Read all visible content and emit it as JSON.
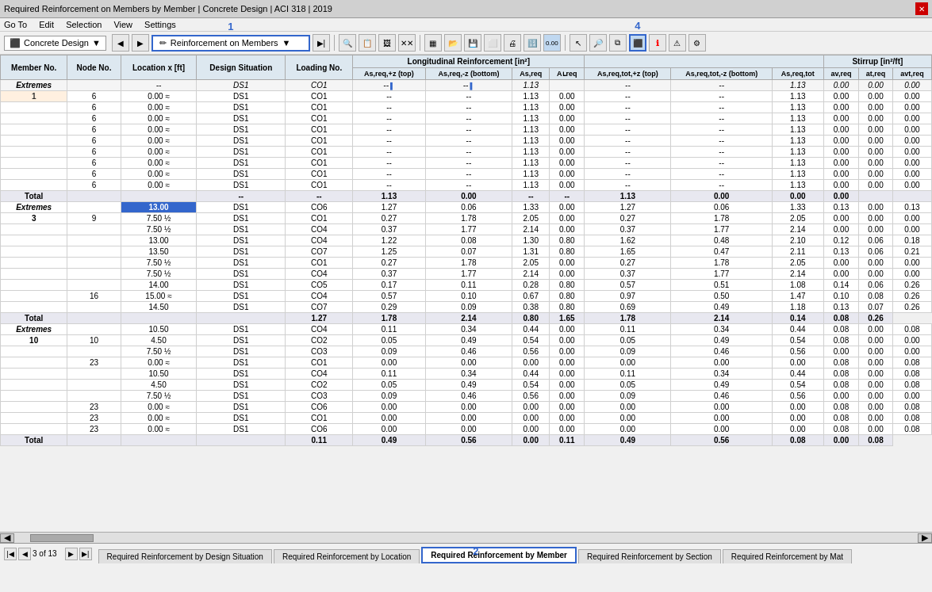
{
  "titleBar": {
    "text": "Required Reinforcement on Members by Member | Concrete Design | ACI 318 | 2019",
    "closeLabel": "✕"
  },
  "menuBar": {
    "items": [
      "Go To",
      "Edit",
      "Selection",
      "View",
      "Settings"
    ]
  },
  "toolbar": {
    "concreteDesignLabel": "Concrete Design",
    "selectedView": "Reinforcement on Members",
    "label1": "1",
    "label4": "4"
  },
  "tableHeaders": {
    "memberNo": "Member No.",
    "nodeNo": "Node No.",
    "locationX": "Location x [ft]",
    "designSituation": "Design Situation",
    "loadingNo": "Loading No.",
    "longitudinalGroup": "Longitudinal Reinforcement [in²]",
    "stirrupGroup": "Stirrup [in²/ft]",
    "asReqTopPlus": "As,req,+z (top)",
    "asReqBottomMinus": "As,req,-z (bottom)",
    "asReq": "As,req",
    "aAreq": "Aʟreq",
    "asReqTotTopPlus": "As,req,tot,+z (top)",
    "asReqTotBottomMinus": "As,req,tot,-z (bottom)",
    "asReqTot": "As,req,tot",
    "avReq": "av,req",
    "atReq": "at,req",
    "avtReq": "avt,req"
  },
  "sections": [
    {
      "type": "extremes",
      "memberNo": "Extremes",
      "rows": [
        {
          "nodeNo": "",
          "location": "--",
          "design": "DS1",
          "loading": "CO1",
          "top": "--",
          "bottom": "--",
          "asreq": "1.13",
          "aareq": "",
          "totTop": "--",
          "totBottom": "--",
          "totAs": "1.13",
          "av": "0.00",
          "at": "0.00",
          "avt": "0.00",
          "hasIndicatorTop": false,
          "hasIndicatorBottom": false
        }
      ],
      "memberLabel": "1",
      "dataRows": [
        {
          "nodeNo": "6",
          "location": "0.00 ≈",
          "design": "DS1",
          "loading": "CO1",
          "top": "--",
          "bottom": "--",
          "asreq": "1.13",
          "aareq": "0.00",
          "totTop": "--",
          "totBottom": "--",
          "totAs": "1.13",
          "av": "0.00",
          "at": "0.00",
          "avt": "0.00"
        },
        {
          "nodeNo": "6",
          "location": "0.00 ≈",
          "design": "DS1",
          "loading": "CO1",
          "top": "--",
          "bottom": "--",
          "asreq": "1.13",
          "aareq": "0.00",
          "totTop": "--",
          "totBottom": "--",
          "totAs": "1.13",
          "av": "0.00",
          "at": "0.00",
          "avt": "0.00",
          "indB": true
        },
        {
          "nodeNo": "6",
          "location": "0.00 ≈",
          "design": "DS1",
          "loading": "CO1",
          "top": "--",
          "bottom": "--",
          "asreq": "1.13",
          "aareq": "0.00",
          "totTop": "--",
          "totBottom": "--",
          "totAs": "1.13",
          "av": "0.00",
          "at": "0.00",
          "avt": "0.00",
          "indB2": true
        },
        {
          "nodeNo": "6",
          "location": "0.00 ≈",
          "design": "DS1",
          "loading": "CO1",
          "top": "--",
          "bottom": "--",
          "asreq": "1.13",
          "aareq": "0.00",
          "totTop": "--",
          "totBottom": "--",
          "totAs": "1.13",
          "av": "0.00",
          "at": "0.00",
          "avt": "0.00"
        },
        {
          "nodeNo": "6",
          "location": "0.00 ≈",
          "design": "DS1",
          "loading": "CO1",
          "top": "--",
          "bottom": "--",
          "asreq": "1.13",
          "aareq": "0.00",
          "totTop": "--",
          "totBottom": "--",
          "totAs": "1.13",
          "av": "0.00",
          "at": "0.00",
          "avt": "0.00"
        },
        {
          "nodeNo": "6",
          "location": "0.00 ≈",
          "design": "DS1",
          "loading": "CO1",
          "top": "--",
          "bottom": "--",
          "asreq": "1.13",
          "aareq": "0.00",
          "totTop": "--",
          "totBottom": "--",
          "totAs": "1.13",
          "av": "0.00",
          "at": "0.00",
          "avt": "0.00",
          "indT": true
        },
        {
          "nodeNo": "6",
          "location": "0.00 ≈",
          "design": "DS1",
          "loading": "CO1",
          "top": "--",
          "bottom": "--",
          "asreq": "1.13",
          "aareq": "0.00",
          "totTop": "--",
          "totBottom": "--",
          "totAs": "1.13",
          "av": "0.00",
          "at": "0.00",
          "avt": "0.00",
          "indTot": true
        },
        {
          "nodeNo": "6",
          "location": "0.00 ≈",
          "design": "DS1",
          "loading": "CO1",
          "top": "--",
          "bottom": "--",
          "asreq": "1.13",
          "aareq": "0.00",
          "totTop": "--",
          "totBottom": "--",
          "totAs": "1.13",
          "av": "0.00",
          "at": "0.00",
          "avt": "0.00",
          "indAt": true
        },
        {
          "nodeNo": "6",
          "location": "0.00 ≈",
          "design": "DS1",
          "loading": "CO1",
          "top": "--",
          "bottom": "--",
          "asreq": "1.13",
          "aareq": "0.00",
          "totTop": "--",
          "totBottom": "--",
          "totAs": "1.13",
          "av": "0.00",
          "at": "0.00",
          "avt": "0.00",
          "indAvt": true
        }
      ],
      "total": {
        "top": "--",
        "bottom": "--",
        "asreq": "1.13",
        "aareq": "0.00",
        "totTop": "--",
        "totBottom": "--",
        "totAs": "1.13",
        "av": "0.00",
        "at": "0.00",
        "avt": "0.00"
      }
    }
  ],
  "section3": {
    "memberNo": "3",
    "extremes": {
      "nodeNo": "",
      "location": "13.00",
      "design": "DS1",
      "loading": "CO6",
      "top": "1.27",
      "bottom": "0.06",
      "asreq": "1.33",
      "aareq": "0.00",
      "totTop": "1.27",
      "totBottom": "0.06",
      "totAs": "1.33",
      "av": "0.13",
      "at": "0.00",
      "avt": "0.13",
      "highlighted": true
    },
    "rows": [
      {
        "nodeNo": "9",
        "location": "7.50 ½",
        "design": "DS1",
        "loading": "CO1",
        "top": "0.27",
        "bottom": "1.78",
        "asreq": "2.05",
        "aareq": "0.00",
        "totTop": "0.27",
        "totBottom": "1.78",
        "totAs": "2.05",
        "av": "0.00",
        "at": "0.00",
        "avt": "0.00",
        "indB": true
      },
      {
        "nodeNo": "",
        "location": "7.50 ½",
        "design": "DS1",
        "loading": "CO4",
        "top": "0.37",
        "bottom": "1.77",
        "asreq": "2.14",
        "aareq": "0.00",
        "totTop": "0.37",
        "totBottom": "1.77",
        "totAs": "2.14",
        "av": "0.00",
        "at": "0.00",
        "avt": "0.00",
        "indT": true
      },
      {
        "nodeNo": "",
        "location": "13.00",
        "design": "DS1",
        "loading": "CO4",
        "top": "1.22",
        "bottom": "0.08",
        "asreq": "1.30",
        "aareq": "0.80",
        "totTop": "1.62",
        "totBottom": "0.48",
        "totAs": "2.10",
        "av": "0.12",
        "at": "0.06",
        "avt": "0.18"
      },
      {
        "nodeNo": "",
        "location": "13.50",
        "design": "DS1",
        "loading": "CO7",
        "top": "1.25",
        "bottom": "0.07",
        "asreq": "1.31",
        "aareq": "0.80",
        "totTop": "1.65",
        "totBottom": "0.47",
        "totAs": "2.11",
        "av": "0.13",
        "at": "0.06",
        "avt": "0.21",
        "indTot2": true
      },
      {
        "nodeNo": "",
        "location": "7.50 ½",
        "design": "DS1",
        "loading": "CO1",
        "top": "0.27",
        "bottom": "1.78",
        "asreq": "2.05",
        "aareq": "0.00",
        "totTop": "0.27",
        "totBottom": "1.78",
        "totAs": "2.05",
        "av": "0.00",
        "at": "0.00",
        "avt": "0.00",
        "indB2": true,
        "indTot3": true
      },
      {
        "nodeNo": "",
        "location": "7.50 ½",
        "design": "DS1",
        "loading": "CO4",
        "top": "0.37",
        "bottom": "1.77",
        "asreq": "2.14",
        "aareq": "0.00",
        "totTop": "0.37",
        "totBottom": "1.77",
        "totAs": "2.14",
        "av": "0.00",
        "at": "0.00",
        "avt": "0.00",
        "indT2": true
      },
      {
        "nodeNo": "",
        "location": "14.00",
        "design": "DS1",
        "loading": "CO5",
        "top": "0.17",
        "bottom": "0.11",
        "asreq": "0.28",
        "aareq": "0.80",
        "totTop": "0.57",
        "totBottom": "0.51",
        "totAs": "1.08",
        "av": "0.14",
        "at": "0.06",
        "avt": "0.26",
        "indAv": true
      },
      {
        "nodeNo": "16",
        "location": "15.00 ≈",
        "design": "DS1",
        "loading": "CO4",
        "top": "0.57",
        "bottom": "0.10",
        "asreq": "0.67",
        "aareq": "0.80",
        "totTop": "0.97",
        "totBottom": "0.50",
        "totAs": "1.47",
        "av": "0.10",
        "at": "0.08",
        "avt": "0.26",
        "indAt2": true
      },
      {
        "nodeNo": "",
        "location": "14.50",
        "design": "DS1",
        "loading": "CO7",
        "top": "0.29",
        "bottom": "0.09",
        "asreq": "0.38",
        "aareq": "0.80",
        "totTop": "0.69",
        "totBottom": "0.49",
        "totAs": "1.18",
        "av": "0.13",
        "at": "0.07",
        "avt": "0.26"
      }
    ],
    "total": {
      "top": "1.27",
      "bottom": "1.78",
      "asreq": "2.14",
      "aareq": "0.80",
      "totTop": "1.65",
      "totBottom": "1.78",
      "totAs": "2.14",
      "av": "0.14",
      "at": "0.08",
      "avt": "0.26"
    }
  },
  "section10": {
    "memberNo": "10",
    "extremes": {
      "location": "10.50",
      "design": "DS1",
      "loading": "CO4",
      "top": "0.11",
      "bottom": "0.34",
      "asreq": "0.44",
      "aareq": "0.00",
      "totTop": "0.11",
      "totBottom": "0.34",
      "totAs": "0.44",
      "av": "0.08",
      "at": "0.00",
      "avt": "0.08",
      "indT": true
    },
    "rows": [
      {
        "nodeNo": "",
        "location": "4.50",
        "design": "DS1",
        "loading": "CO2",
        "top": "0.05",
        "bottom": "0.49",
        "asreq": "0.54",
        "aareq": "0.00",
        "totTop": "0.05",
        "totBottom": "0.49",
        "totAs": "0.54",
        "av": "0.08",
        "at": "0.00",
        "avt": "0.00",
        "indB": true
      },
      {
        "nodeNo": "",
        "location": "7.50 ½",
        "design": "DS1",
        "loading": "CO3",
        "top": "0.09",
        "bottom": "0.46",
        "asreq": "0.56",
        "aareq": "0.00",
        "totTop": "0.09",
        "totBottom": "0.46",
        "totAs": "0.56",
        "av": "0.00",
        "at": "0.00",
        "avt": "0.00",
        "indT2": true
      },
      {
        "nodeNo": "23",
        "location": "0.00 ≈",
        "design": "DS1",
        "loading": "CO1",
        "top": "0.00",
        "bottom": "0.00",
        "asreq": "0.00",
        "aareq": "0.00",
        "totTop": "0.00",
        "totBottom": "0.00",
        "totAs": "0.00",
        "av": "0.08",
        "at": "0.00",
        "avt": "0.08",
        "indAareq": true
      },
      {
        "nodeNo": "",
        "location": "10.50",
        "design": "DS1",
        "loading": "CO4",
        "top": "0.11",
        "bottom": "0.34",
        "asreq": "0.44",
        "aareq": "0.00",
        "totTop": "0.11",
        "totBottom": "0.34",
        "totAs": "0.44",
        "av": "0.08",
        "at": "0.00",
        "avt": "0.08",
        "indTot": true
      },
      {
        "nodeNo": "",
        "location": "4.50",
        "design": "DS1",
        "loading": "CO2",
        "top": "0.05",
        "bottom": "0.49",
        "asreq": "0.54",
        "aareq": "0.00",
        "totTop": "0.05",
        "totBottom": "0.49",
        "totAs": "0.54",
        "av": "0.08",
        "at": "0.00",
        "avt": "0.08",
        "indB2": true
      },
      {
        "nodeNo": "",
        "location": "7.50 ½",
        "design": "DS1",
        "loading": "CO3",
        "top": "0.09",
        "bottom": "0.46",
        "asreq": "0.56",
        "aareq": "0.00",
        "totTop": "0.09",
        "totBottom": "0.46",
        "totAs": "0.56",
        "av": "0.00",
        "at": "0.00",
        "avt": "0.00",
        "indTot2": true
      },
      {
        "nodeNo": "23",
        "location": "0.00 ≈",
        "design": "DS1",
        "loading": "CO6",
        "top": "0.00",
        "bottom": "0.00",
        "asreq": "0.00",
        "aareq": "0.00",
        "totTop": "0.00",
        "totBottom": "0.00",
        "totAs": "0.00",
        "av": "0.08",
        "at": "0.00",
        "avt": "0.08",
        "indAv": true
      },
      {
        "nodeNo": "23",
        "location": "0.00 ≈",
        "design": "DS1",
        "loading": "CO1",
        "top": "0.00",
        "bottom": "0.00",
        "asreq": "0.00",
        "aareq": "0.00",
        "totTop": "0.00",
        "totBottom": "0.00",
        "totAs": "0.00",
        "av": "0.08",
        "at": "0.00",
        "avt": "0.08",
        "indAt": true
      },
      {
        "nodeNo": "23",
        "location": "0.00 ≈",
        "design": "DS1",
        "loading": "CO6",
        "top": "0.00",
        "bottom": "0.00",
        "asreq": "0.00",
        "aareq": "0.00",
        "totTop": "0.00",
        "totBottom": "0.00",
        "totAs": "0.00",
        "av": "0.08",
        "at": "0.00",
        "avt": "0.08",
        "indAvt": true
      }
    ],
    "total": {
      "top": "0.11",
      "bottom": "0.49",
      "asreq": "0.56",
      "aareq": "0.00",
      "totTop": "0.11",
      "totBottom": "0.49",
      "totAs": "0.56",
      "av": "0.08",
      "at": "0.00",
      "avt": "0.08"
    }
  },
  "bottomBar": {
    "pageInfo": "3 of 13",
    "tabs": [
      {
        "label": "Required Reinforcement by Design Situation",
        "active": false
      },
      {
        "label": "Required Reinforcement by Location",
        "active": false
      },
      {
        "label": "Required Reinforcement by Member",
        "active": true
      },
      {
        "label": "Required Reinforcement by Section",
        "active": false
      },
      {
        "label": "Required Reinforcement by Mat",
        "active": false
      }
    ],
    "label2": "2"
  }
}
